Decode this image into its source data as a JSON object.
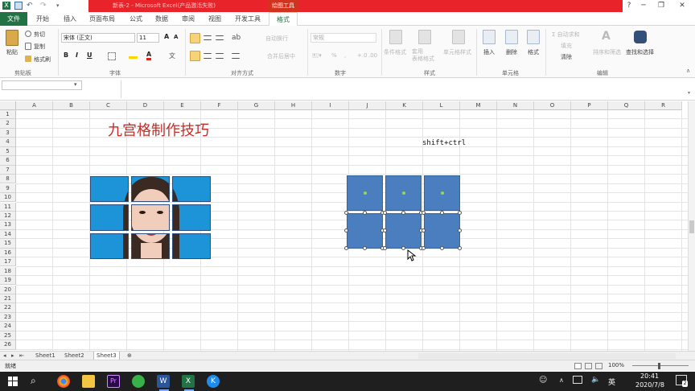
{
  "window": {
    "title": "新表-2 - Microsoft Excel(产品激活失败)",
    "context_tab": "绘图工具",
    "minimize": "─",
    "restore": "❐",
    "close": "✕",
    "help": "?"
  },
  "tabs": [
    "文件",
    "开始",
    "插入",
    "页面布局",
    "公式",
    "数据",
    "审阅",
    "视图",
    "开发工具",
    "格式"
  ],
  "ribbon": {
    "clipboard": {
      "paste": "粘贴",
      "cut": "剪切",
      "copy": "复制",
      "format_painter": "格式刷",
      "label": "剪贴板"
    },
    "font": {
      "name": "宋体 (正文)",
      "size": "11",
      "grow": "A",
      "shrink": "A",
      "bold": "B",
      "italic": "I",
      "underline": "U",
      "label": "字体"
    },
    "alignment": {
      "wrap": "自动换行",
      "merge": "合并后居中",
      "label": "对齐方式"
    },
    "number": {
      "format": "常规",
      "percent": "%",
      "comma": ",",
      "label": "数字"
    },
    "styles": {
      "conditional": "条件格式",
      "table": "套用\n表格格式",
      "cell": "单元格样式",
      "label": "样式"
    },
    "cells": {
      "insert": "插入",
      "delete": "删除",
      "format": "格式",
      "label": "单元格"
    },
    "editing": {
      "autosum": "Σ 自动求和",
      "fill": "填充",
      "clear": "清除",
      "sort": "排序和筛选",
      "find": "查找和选择",
      "label": "编辑"
    }
  },
  "columns": [
    "A",
    "B",
    "C",
    "D",
    "E",
    "F",
    "G",
    "H",
    "I",
    "J",
    "K",
    "L",
    "M",
    "N",
    "O",
    "P",
    "Q",
    "R"
  ],
  "rows": [
    "1",
    "2",
    "3",
    "4",
    "5",
    "6",
    "7",
    "8",
    "9",
    "10",
    "11",
    "12",
    "13",
    "14",
    "15",
    "16",
    "17",
    "18",
    "19",
    "20",
    "21",
    "22",
    "23",
    "24",
    "25",
    "26"
  ],
  "sheet": {
    "title_text": "九宫格制作技巧",
    "note_text": "shift+ctrl"
  },
  "sheet_tabs": [
    "Sheet1",
    "Sheet2",
    "Sheet3"
  ],
  "status": {
    "ready": "就绪",
    "zoom": "100%"
  },
  "taskbar": {
    "time": "20:41",
    "date": "2020/7/8",
    "ime": "英",
    "notification": "2"
  },
  "colors": {
    "excel_green": "#217346",
    "title_red": "#e8232a",
    "shape_blue": "#4a7ebf",
    "text_red": "#c0302a"
  }
}
